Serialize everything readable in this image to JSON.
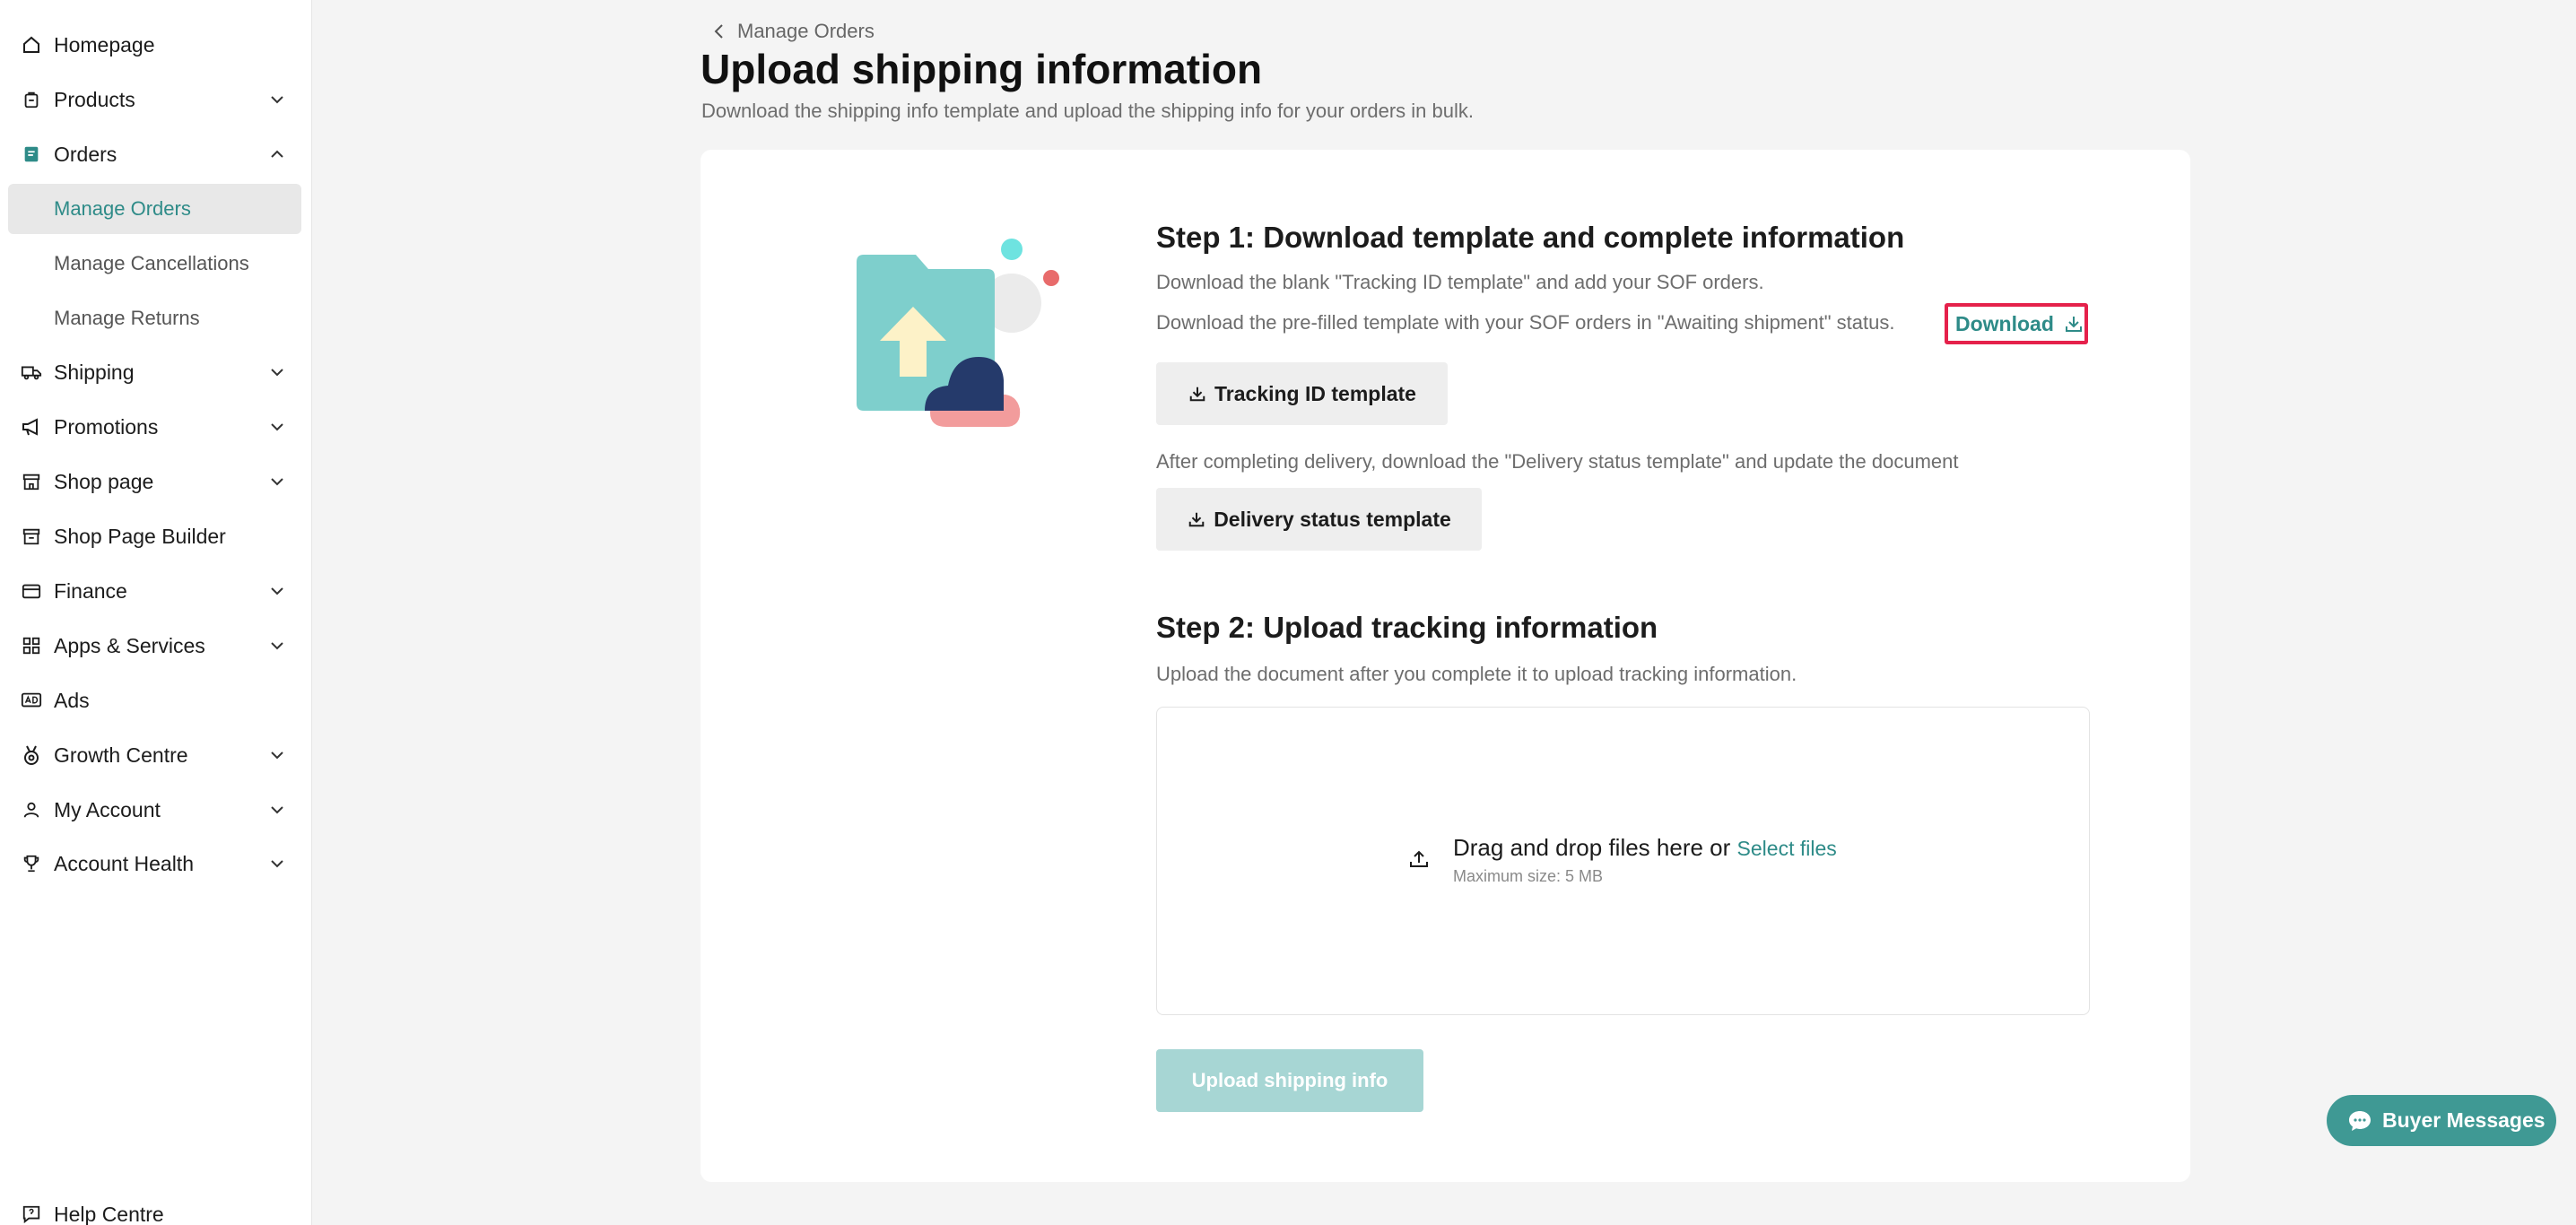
{
  "sidebar": {
    "items": [
      {
        "label": "Homepage",
        "icon": "home-icon"
      },
      {
        "label": "Products",
        "icon": "product-bag-icon"
      },
      {
        "label": "Orders",
        "icon": "orders-icon"
      },
      {
        "label": "Shipping",
        "icon": "truck-icon"
      },
      {
        "label": "Promotions",
        "icon": "megaphone-icon"
      },
      {
        "label": "Shop page",
        "icon": "storefront-icon"
      },
      {
        "label": "Shop Page Builder",
        "icon": "storefront-builder-icon"
      },
      {
        "label": "Finance",
        "icon": "wallet-icon"
      },
      {
        "label": "Apps & Services",
        "icon": "apps-grid-icon"
      },
      {
        "label": "Ads",
        "icon": "ads-icon"
      },
      {
        "label": "Growth Centre",
        "icon": "medal-icon"
      },
      {
        "label": "My Account",
        "icon": "user-icon"
      },
      {
        "label": "Account Health",
        "icon": "trophy-icon"
      }
    ],
    "orders_sub": [
      {
        "label": "Manage Orders"
      },
      {
        "label": "Manage Cancellations"
      },
      {
        "label": "Manage Returns"
      }
    ],
    "help": {
      "label": "Help Centre",
      "icon": "help-icon"
    }
  },
  "breadcrumb": {
    "label": "Manage Orders"
  },
  "page": {
    "title": "Upload shipping information",
    "subtitle": "Download the shipping info template and upload the shipping info for your orders in bulk."
  },
  "step1": {
    "title": "Step 1: Download template and complete information",
    "desc1": "Download the blank \"Tracking ID template\" and add your SOF orders.",
    "desc2": "Download the pre-filled template with your SOF orders in \"Awaiting shipment\" status.",
    "download_link": "Download",
    "tracking_btn": "Tracking ID template",
    "desc3": "After completing delivery, download the \"Delivery status template\" and update the document",
    "delivery_btn": "Delivery status template"
  },
  "step2": {
    "title": "Step 2: Upload tracking information",
    "desc": "Upload the document after you complete it to upload tracking information.",
    "dropzone_text": "Drag and drop files here or",
    "select_files": "Select files",
    "max_size": "Maximum size: 5 MB",
    "upload_btn": "Upload shipping info"
  },
  "buyer_messages": {
    "label": "Buyer Messages"
  },
  "colors": {
    "accent": "#2e8b88",
    "highlight_border": "#e5214b",
    "disabled_btn": "#a7d6d4"
  }
}
